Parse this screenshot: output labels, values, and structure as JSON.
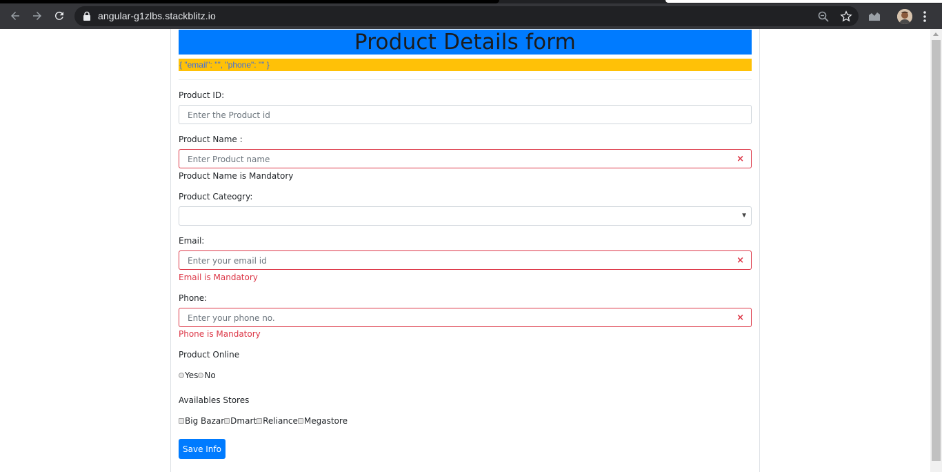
{
  "browser": {
    "url": "angular-g1zlbs.stackblitz.io"
  },
  "page": {
    "title": "Product Details form",
    "form_json": "{ \"email\": \"\", \"phone\": \"\" }",
    "product_id": {
      "label": "Product ID:",
      "placeholder": "Enter the Product id"
    },
    "product_name": {
      "label": "Product Name :",
      "placeholder": "Enter Product name",
      "error": "Product Name is Mandatory"
    },
    "product_category": {
      "label": "Product Cateogry:",
      "selected": ""
    },
    "email": {
      "label": "Email:",
      "placeholder": "Enter your email id",
      "error": "Email is Mandatory"
    },
    "phone": {
      "label": "Phone:",
      "placeholder": "Enter your phone no.",
      "error": "Phone is Mandatory"
    },
    "product_online": {
      "label": "Product Online",
      "options": [
        "Yes",
        "No"
      ]
    },
    "stores": {
      "label": "Availables Stores",
      "options": [
        "Big Bazar",
        "Dmart",
        "Reliance",
        "Megastore"
      ]
    },
    "save_label": "Save Info",
    "error_mark": "×"
  },
  "colors": {
    "header_bg": "#007bff",
    "json_bg": "#ffc107",
    "invalid": "#dc3545",
    "button_bg": "#007bff"
  },
  "icons": {
    "nav": [
      "back-arrow-icon",
      "forward-arrow-icon",
      "reload-icon"
    ],
    "omnibox": [
      "lock-icon",
      "zoom-icon",
      "star-icon"
    ],
    "toolbar": [
      "extension-icon",
      "avatar",
      "menu-icon"
    ]
  }
}
